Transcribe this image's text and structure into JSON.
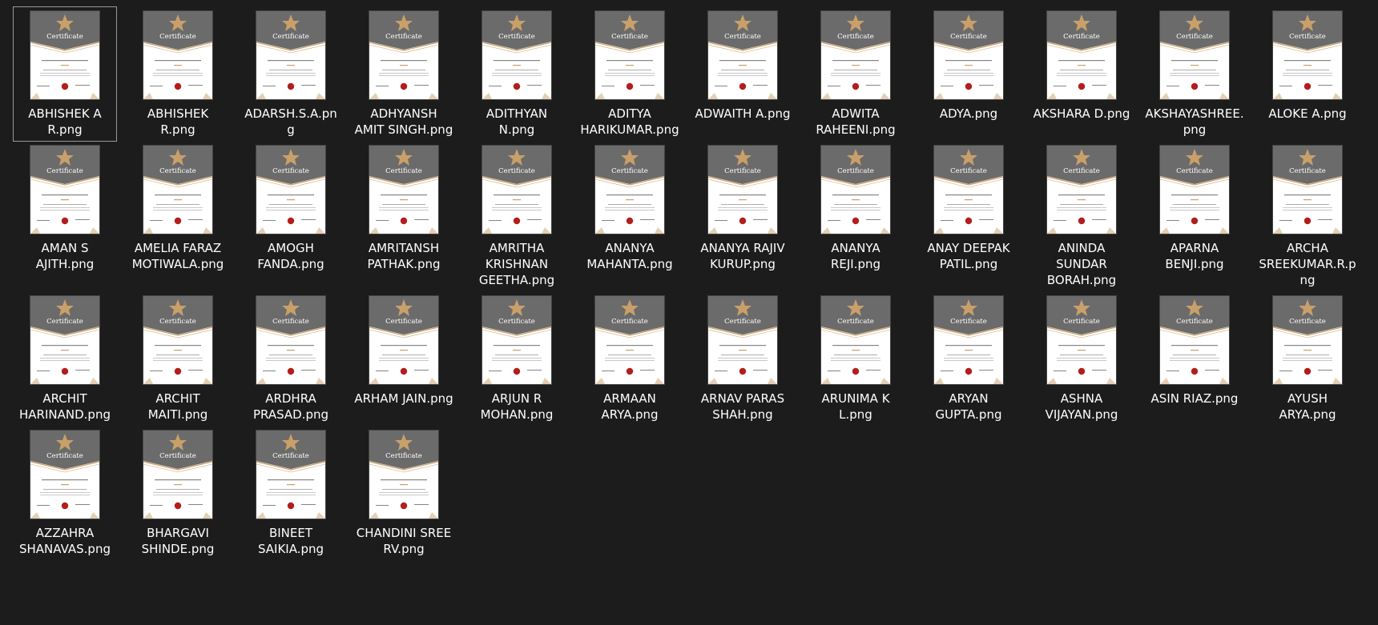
{
  "window": {
    "view": "large-icons",
    "selected_index": 0
  },
  "thumbnail": {
    "heading": "Certificate",
    "icon": "certificate-image-icon",
    "colors": {
      "banner": "#6b6b6b",
      "banner_dark": "#555555",
      "gold": "#c9a06a",
      "paper": "#ffffff",
      "seal": "#b31d1d",
      "text": "#333333"
    }
  },
  "files": [
    {
      "name": "ABHISHEK A R.png"
    },
    {
      "name": "ABHISHEK R.png"
    },
    {
      "name": "ADARSH.S.A.png"
    },
    {
      "name": "ADHYANSH AMIT SINGH.png"
    },
    {
      "name": "ADITHYAN N.png"
    },
    {
      "name": "ADITYA HARIKUMAR.png"
    },
    {
      "name": "ADWAITH A.png"
    },
    {
      "name": "ADWITA RAHEENI.png"
    },
    {
      "name": "ADYA.png"
    },
    {
      "name": "AKSHARA D.png"
    },
    {
      "name": "AKSHAYASHREE.png"
    },
    {
      "name": "ALOKE A.png"
    },
    {
      "name": "AMAN S AJITH.png"
    },
    {
      "name": "AMELIA FARAZ MOTIWALA.png"
    },
    {
      "name": "AMOGH FANDA.png"
    },
    {
      "name": "AMRITANSH PATHAK.png"
    },
    {
      "name": "AMRITHA KRISHNAN GEETHA.png"
    },
    {
      "name": "ANANYA MAHANTA.png"
    },
    {
      "name": "ANANYA RAJIV KURUP.png"
    },
    {
      "name": "ANANYA REJI.png"
    },
    {
      "name": "ANAY DEEPAK PATIL.png"
    },
    {
      "name": "ANINDA SUNDAR BORAH.png"
    },
    {
      "name": "APARNA BENJI.png"
    },
    {
      "name": "ARCHA SREEKUMAR.R.png"
    },
    {
      "name": "ARCHIT HARINAND.png"
    },
    {
      "name": "ARCHIT MAITI.png"
    },
    {
      "name": "ARDHRA PRASAD.png"
    },
    {
      "name": "ARHAM JAIN.png"
    },
    {
      "name": "ARJUN R MOHAN.png"
    },
    {
      "name": "ARMAAN ARYA.png"
    },
    {
      "name": "ARNAV PARAS SHAH.png"
    },
    {
      "name": "ARUNIMA K L.png"
    },
    {
      "name": "ARYAN GUPTA.png"
    },
    {
      "name": "ASHNA VIJAYAN.png"
    },
    {
      "name": "ASIN RIAZ.png"
    },
    {
      "name": "AYUSH ARYA.png"
    },
    {
      "name": "AZZAHRA SHANAVAS.png"
    },
    {
      "name": "BHARGAVI SHINDE.png"
    },
    {
      "name": "BINEET SAIKIA.png"
    },
    {
      "name": "CHANDINI SREE RV.png"
    }
  ]
}
